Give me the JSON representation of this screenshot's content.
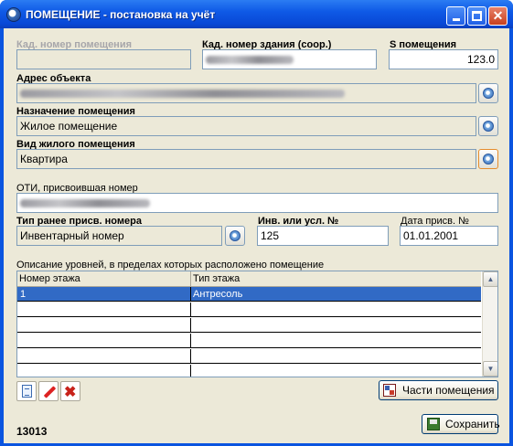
{
  "window": {
    "title": "ПОМЕЩЕНИЕ - постановка на учёт"
  },
  "fields": {
    "cadastral_premises": {
      "label": "Кад. номер помещения",
      "value": ""
    },
    "cadastral_building": {
      "label": "Кад. номер здания (соор.)"
    },
    "area": {
      "label": "S помещения",
      "value": "123.0"
    },
    "address": {
      "label": "Адрес объекта"
    },
    "purpose": {
      "label": "Назначение помещения",
      "value": "Жилое помещение"
    },
    "residential_type": {
      "label": "Вид жилого помещения",
      "value": "Квартира"
    },
    "oti": {
      "label": "ОТИ, присвоившая номер"
    },
    "prev_number_type": {
      "label": "Тип ранее присв. номера",
      "value": "Инвентарный номер"
    },
    "inv_number": {
      "label": "Инв. или усл. №",
      "value": "125"
    },
    "assign_date": {
      "label": "Дата присв. №",
      "value": "01.01.2001"
    }
  },
  "levels": {
    "caption": "Описание уровней, в пределах которых расположено помещение",
    "columns": [
      "Номер этажа",
      "Тип этажа"
    ],
    "rows": [
      {
        "floor": "1",
        "type": "Антресоль",
        "selected": true
      },
      {
        "floor": "",
        "type": ""
      },
      {
        "floor": "",
        "type": ""
      },
      {
        "floor": "",
        "type": ""
      },
      {
        "floor": "",
        "type": ""
      },
      {
        "floor": "",
        "type": ""
      }
    ]
  },
  "buttons": {
    "parts": "Части помещения",
    "save": "Сохранить"
  },
  "record_number": "13013",
  "icons": [
    "app-icon",
    "minimize-icon",
    "maximize-icon",
    "close-icon",
    "lookup-icon",
    "new-record-icon",
    "edit-icon",
    "delete-icon",
    "parts-icon",
    "save-icon"
  ],
  "colors": {
    "titlebar": "#0a54e0",
    "selection": "#316ac5",
    "dialog_bg": "#ece9d8"
  }
}
